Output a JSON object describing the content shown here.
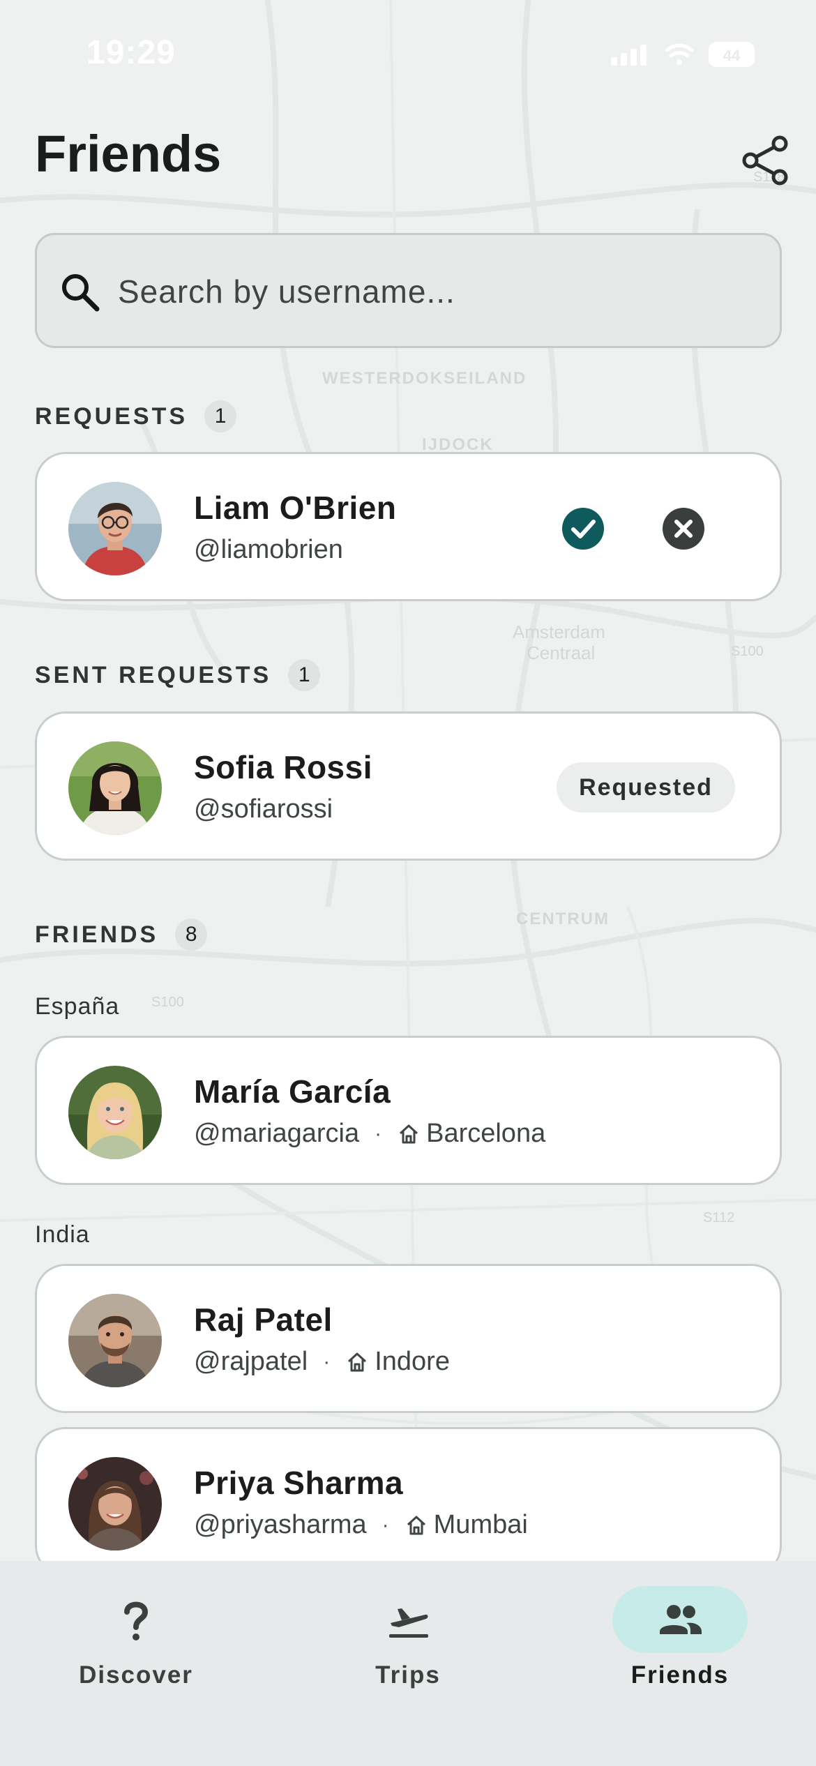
{
  "status_bar": {
    "time": "19:29",
    "battery": "44"
  },
  "header": {
    "title": "Friends"
  },
  "search": {
    "placeholder": "Search by username..."
  },
  "sections": {
    "requests": {
      "label": "REQUESTS",
      "count": "1"
    },
    "sent_requests": {
      "label": "SENT REQUESTS",
      "count": "1"
    },
    "friends": {
      "label": "FRIENDS",
      "count": "8"
    }
  },
  "request": {
    "name": "Liam O'Brien",
    "username": "@liamobrien"
  },
  "sent_request": {
    "name": "Sofia Rossi",
    "username": "@sofiarossi",
    "status": "Requested"
  },
  "friend_groups": [
    {
      "country": "España",
      "friends": [
        {
          "name": "María García",
          "username": "@mariagarcia",
          "city": "Barcelona"
        }
      ]
    },
    {
      "country": "India",
      "friends": [
        {
          "name": "Raj Patel",
          "username": "@rajpatel",
          "city": "Indore"
        },
        {
          "name": "Priya Sharma",
          "username": "@priyasharma",
          "city": "Mumbai"
        }
      ]
    }
  ],
  "separator": "·",
  "map_labels": {
    "district1": "WESTERDOKSEILAND",
    "district2": "IJDOCK",
    "district3": "CENTRUM",
    "station1": "Amsterdam",
    "station2": "Centraal",
    "road1": "S100",
    "road2": "S100",
    "road3": "S112",
    "road4": "S118"
  },
  "tabs": [
    {
      "label": "Discover",
      "icon": "question-icon"
    },
    {
      "label": "Trips",
      "icon": "plane-departure-icon"
    },
    {
      "label": "Friends",
      "icon": "people-icon"
    }
  ],
  "colors": {
    "accent": "#0f5a5c",
    "decline": "#3a3f3d",
    "active_tab_bg": "#c7ebe9",
    "tab_bar_bg": "#e7eaea"
  }
}
